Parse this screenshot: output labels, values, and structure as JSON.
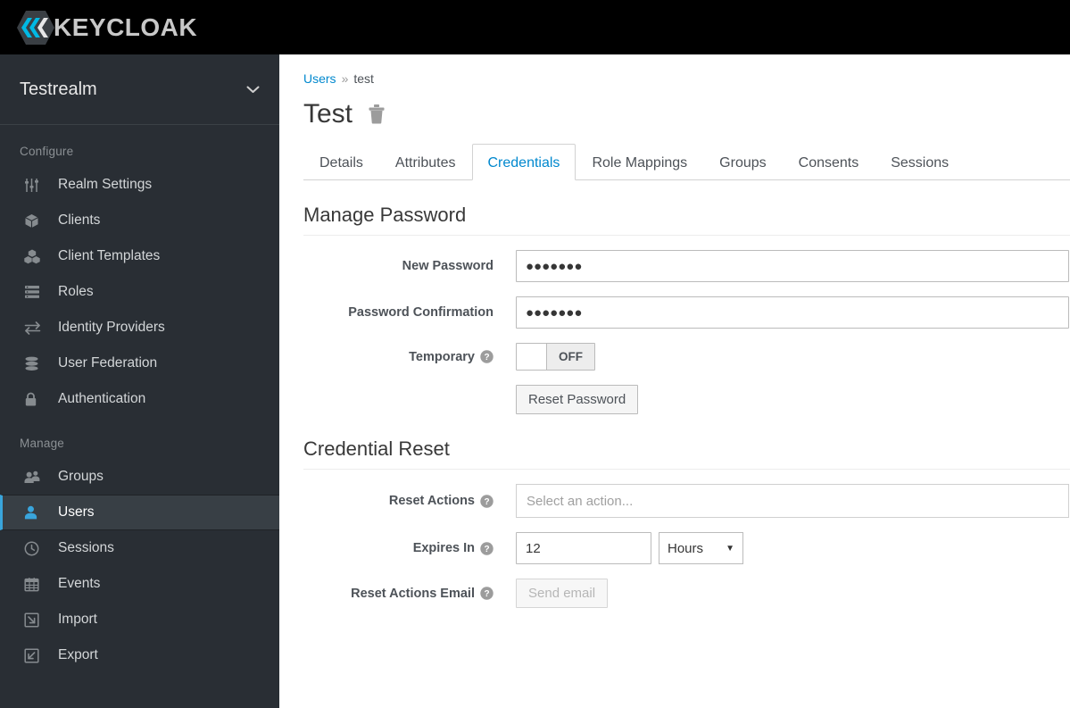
{
  "brand": {
    "name": "KEYCLOAK",
    "logo_icon": "keycloak-hexagon-logo"
  },
  "sidebar": {
    "realm": {
      "name": "Testrealm",
      "caret_icon": "chevron-down-icon"
    },
    "sections": [
      {
        "label": "Configure",
        "items": [
          {
            "label": "Realm Settings",
            "icon": "sliders-icon",
            "active": false
          },
          {
            "label": "Clients",
            "icon": "cube-icon",
            "active": false
          },
          {
            "label": "Client Templates",
            "icon": "cubes-icon",
            "active": false
          },
          {
            "label": "Roles",
            "icon": "server-stack-icon",
            "active": false
          },
          {
            "label": "Identity Providers",
            "icon": "exchange-arrows-icon",
            "active": false
          },
          {
            "label": "User Federation",
            "icon": "database-icon",
            "active": false
          },
          {
            "label": "Authentication",
            "icon": "lock-icon",
            "active": false
          }
        ]
      },
      {
        "label": "Manage",
        "items": [
          {
            "label": "Groups",
            "icon": "users-icon",
            "active": false
          },
          {
            "label": "Users",
            "icon": "user-icon",
            "active": true
          },
          {
            "label": "Sessions",
            "icon": "clock-icon",
            "active": false
          },
          {
            "label": "Events",
            "icon": "calendar-icon",
            "active": false
          },
          {
            "label": "Import",
            "icon": "import-arrow-icon",
            "active": false
          },
          {
            "label": "Export",
            "icon": "export-arrow-icon",
            "active": false
          }
        ]
      }
    ]
  },
  "breadcrumb": {
    "root": "Users",
    "separator": "»",
    "current": "test"
  },
  "page": {
    "title": "Test",
    "delete_icon": "trash-icon"
  },
  "tabs": [
    {
      "label": "Details",
      "active": false
    },
    {
      "label": "Attributes",
      "active": false
    },
    {
      "label": "Credentials",
      "active": true
    },
    {
      "label": "Role Mappings",
      "active": false
    },
    {
      "label": "Groups",
      "active": false
    },
    {
      "label": "Consents",
      "active": false
    },
    {
      "label": "Sessions",
      "active": false
    }
  ],
  "manage_password": {
    "heading": "Manage Password",
    "new_password": {
      "label": "New Password",
      "value": "●●●●●●●",
      "placeholder": ""
    },
    "password_confirmation": {
      "label": "Password Confirmation",
      "value": "●●●●●●●",
      "placeholder": ""
    },
    "temporary": {
      "label": "Temporary",
      "help_icon": "question-circle-icon",
      "state": "OFF"
    },
    "reset_password_button": "Reset Password"
  },
  "credential_reset": {
    "heading": "Credential Reset",
    "reset_actions": {
      "label": "Reset Actions",
      "help_icon": "question-circle-icon",
      "placeholder": "Select an action..."
    },
    "expires_in": {
      "label": "Expires In",
      "help_icon": "question-circle-icon",
      "value": "12",
      "unit": "Hours",
      "unit_caret_icon": "caret-down-icon"
    },
    "reset_actions_email": {
      "label": "Reset Actions Email",
      "help_icon": "question-circle-icon",
      "button": "Send email",
      "disabled": true
    }
  },
  "colors": {
    "brand_bar": "#000000",
    "sidebar": "#292e34",
    "sidebar_active": "#383f45",
    "accent_blue": "#39a5dc",
    "link_blue": "#0088ce",
    "text_dark": "#4d5258"
  }
}
